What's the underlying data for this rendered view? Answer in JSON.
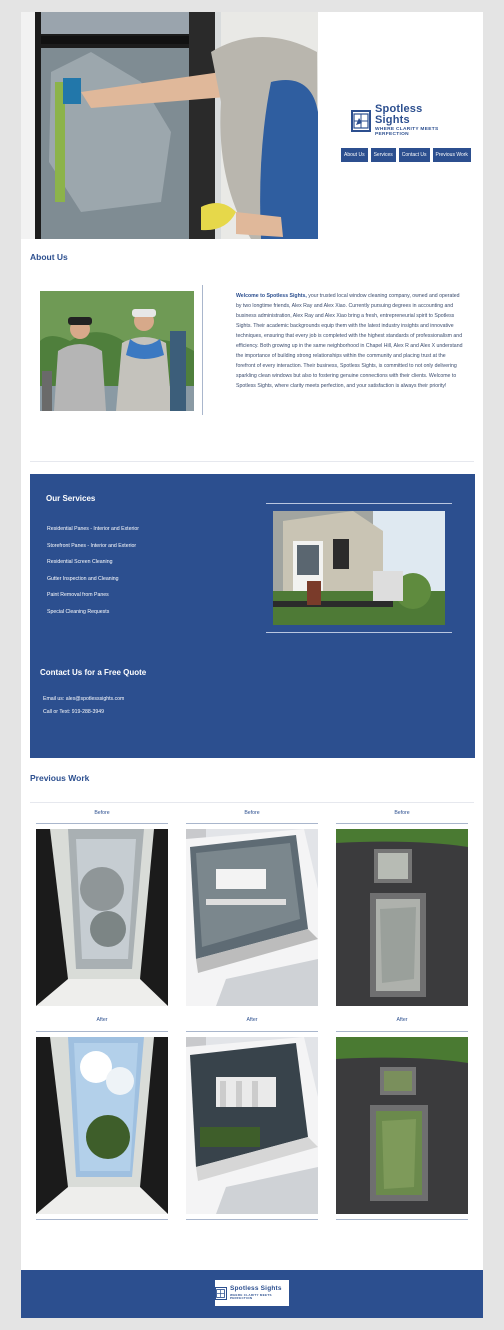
{
  "brand": {
    "name": "Spotless Sights",
    "tagline": "WHERE CLARITY MEETS PERFECTION"
  },
  "nav": {
    "items": [
      "About Us",
      "Services",
      "Contact Us",
      "Previous Work"
    ]
  },
  "about": {
    "heading": "About Us",
    "lead": "Welcome to Spotless Sights,",
    "body": " your trusted local window cleaning company, owned and operated by two longtime friends, Alex Ray and Alex Xiao. Currently pursuing degrees in accounting and business administration, Alex Ray and Alex Xiao bring a fresh, entrepreneurial spirit to Spotless Sights. Their academic backgrounds equip them with the latest industry insights and innovative techniques, ensuring that every job is completed with the highest standards of professionalism and efficiency. Both growing up in the same neighborhood in Chapel Hill, Alex R and Alex X understand the importance of building strong relationships within the community and placing trust at the forefront of every interaction. Their business, Spotless Sights, is committed to not only delivering sparkling clean windows but also to fostering genuine connections with their clients. Welcome to Spotless Sights, where clarity meets perfection, and your satisfaction is always their priority!"
  },
  "services": {
    "heading": "Our Services",
    "items": [
      "Residential Panes - Interior and Exterior",
      "Storefront Panes - Interior and Exterior",
      "Residential Screen Cleaning",
      "Gutter Inspection and Cleaning",
      "Paint Removal from Panes",
      "Special Cleaning Requests"
    ]
  },
  "contact": {
    "heading": "Contact Us for a Free Quote",
    "email": "Email us: alex@spotlesssights.com",
    "phone": "Call or Text: 919-288-3949"
  },
  "work": {
    "heading": "Previous Work",
    "before_label": "Before",
    "after_label": "After"
  },
  "colors": {
    "brand_blue": "#2c4f8f",
    "page_bg": "#e4e4e4"
  }
}
